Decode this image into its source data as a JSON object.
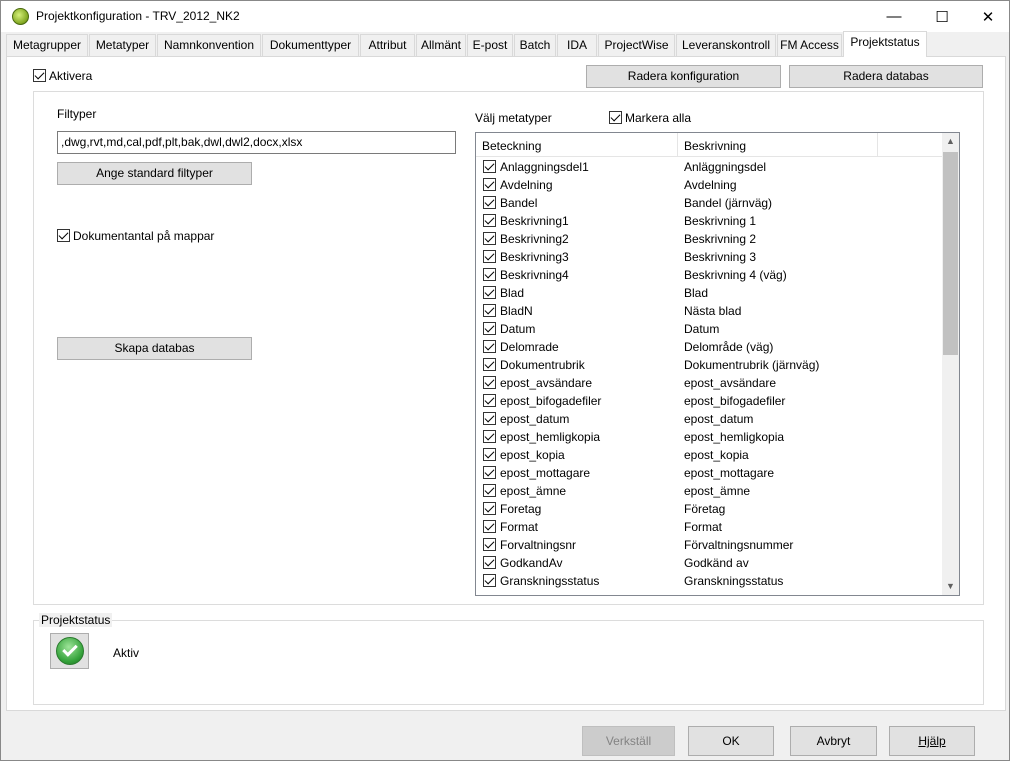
{
  "window": {
    "title": "Projektkonfiguration - TRV_2012_NK2",
    "controls": {
      "minimize": "—",
      "maximize": "☐",
      "close": "✕"
    }
  },
  "tabs": [
    "Metagrupper",
    "Metatyper",
    "Namnkonvention",
    "Dokumenttyper",
    "Attribut",
    "Allmänt",
    "E-post",
    "Batch",
    "IDA",
    "ProjectWise",
    "Leveranskontroll",
    "FM Access",
    "Projektstatus"
  ],
  "active_tab": "Projektstatus",
  "top": {
    "aktivera_label": "Aktivera",
    "aktivera_checked": true,
    "radera_konfiguration": "Radera konfiguration",
    "radera_databas": "Radera databas"
  },
  "left": {
    "filtyper_label": "Filtyper",
    "filtyper_value": ",dwg,rvt,md,cal,pdf,plt,bak,dwl,dwl2,docx,xlsx",
    "standard_button": "Ange standard filtyper",
    "dokumentantal_label": "Dokumentantal på mappar",
    "dokumentantal_checked": true,
    "skapa_databas": "Skapa databas"
  },
  "metatyper": {
    "label": "Välj metatyper",
    "markera_alla": "Markera alla",
    "markera_alla_checked": true,
    "columns": [
      "Beteckning",
      "Beskrivning"
    ],
    "rows": [
      [
        "Anlaggningsdel1",
        "Anläggningsdel"
      ],
      [
        "Avdelning",
        "Avdelning"
      ],
      [
        "Bandel",
        "Bandel (järnväg)"
      ],
      [
        "Beskrivning1",
        "Beskrivning 1"
      ],
      [
        "Beskrivning2",
        "Beskrivning 2"
      ],
      [
        "Beskrivning3",
        "Beskrivning 3"
      ],
      [
        "Beskrivning4",
        "Beskrivning 4 (väg)"
      ],
      [
        "Blad",
        "Blad"
      ],
      [
        "BladN",
        "Nästa blad"
      ],
      [
        "Datum",
        "Datum"
      ],
      [
        "Delomrade",
        "Delområde (väg)"
      ],
      [
        "Dokumentrubrik",
        "Dokumentrubrik (järnväg)"
      ],
      [
        "epost_avsändare",
        "epost_avsändare"
      ],
      [
        "epost_bifogadefiler",
        "epost_bifogadefiler"
      ],
      [
        "epost_datum",
        "epost_datum"
      ],
      [
        "epost_hemligkopia",
        "epost_hemligkopia"
      ],
      [
        "epost_kopia",
        "epost_kopia"
      ],
      [
        "epost_mottagare",
        "epost_mottagare"
      ],
      [
        "epost_ämne",
        "epost_ämne"
      ],
      [
        "Foretag",
        "Företag"
      ],
      [
        "Format",
        "Format"
      ],
      [
        "Forvaltningsnr",
        "Förvaltningsnummer"
      ],
      [
        "GodkandAv",
        "Godkänd av"
      ],
      [
        "Granskningsstatus",
        "Granskningsstatus"
      ]
    ]
  },
  "projektstatus": {
    "label": "Projektstatus",
    "status_text": "Aktiv",
    "status_icon": "green-check-icon"
  },
  "footer": {
    "verkstall": "Verkställ",
    "ok": "OK",
    "avbryt": "Avbryt",
    "hjalp": "Hjälp"
  }
}
